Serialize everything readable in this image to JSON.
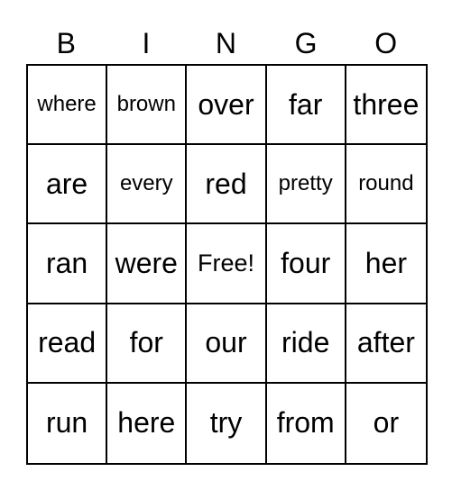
{
  "header": [
    "B",
    "I",
    "N",
    "G",
    "O"
  ],
  "cells": [
    [
      "where",
      "brown",
      "over",
      "far",
      "three"
    ],
    [
      "are",
      "every",
      "red",
      "pretty",
      "round"
    ],
    [
      "ran",
      "were",
      "Free!",
      "four",
      "her"
    ],
    [
      "read",
      "for",
      "our",
      "ride",
      "after"
    ],
    [
      "run",
      "here",
      "try",
      "from",
      "or"
    ]
  ]
}
